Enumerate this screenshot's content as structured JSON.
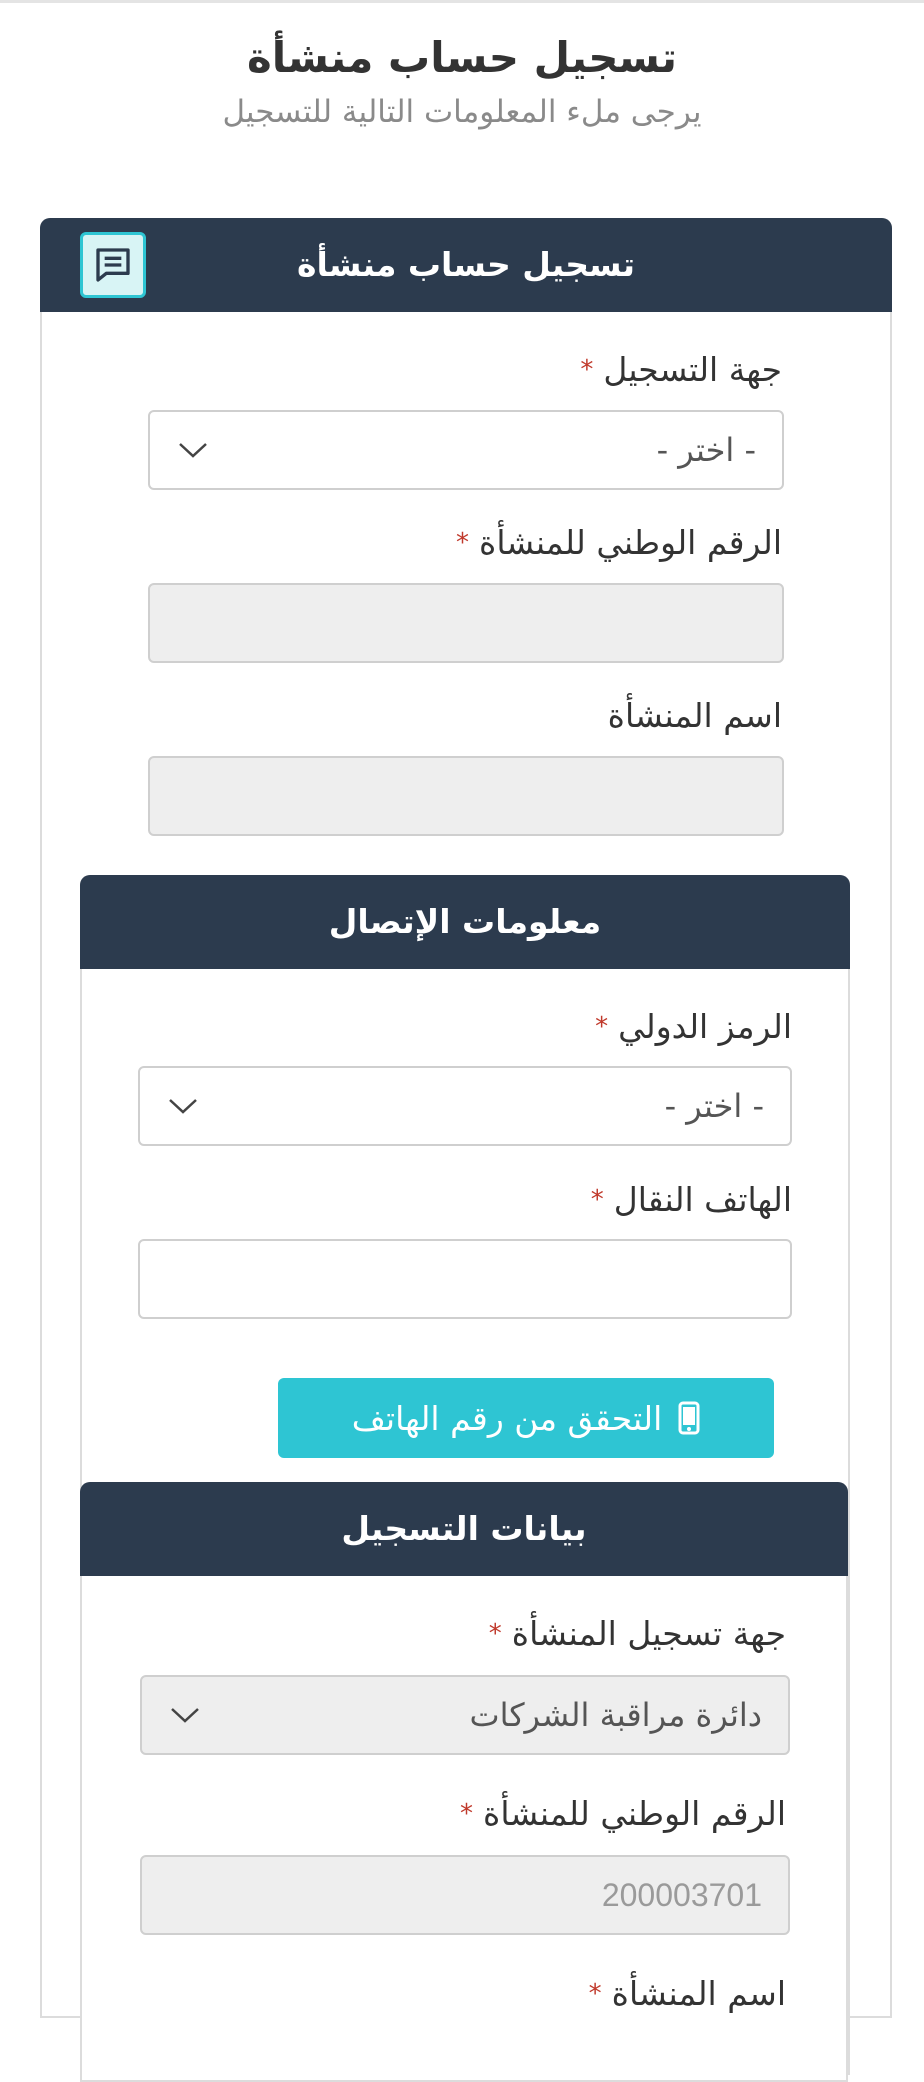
{
  "header": {
    "title": "تسجيل حساب منشأة",
    "subtitle": "يرجى ملء المعلومات التالية للتسجيل"
  },
  "panel_main": {
    "title": "تسجيل حساب منشأة",
    "chat_icon": "chat-icon",
    "registration_authority": {
      "label": "جهة التسجيل",
      "required_mark": "*",
      "value": "- اختر -"
    },
    "national_number": {
      "label": "الرقم الوطني للمنشأة",
      "required_mark": "*",
      "value": ""
    },
    "establishment_name": {
      "label": "اسم المنشأة",
      "value": ""
    }
  },
  "panel_contact": {
    "title": "معلومات الإتصال",
    "country_code": {
      "label": "الرمز الدولي",
      "required_mark": "*",
      "value": "- اختر -"
    },
    "mobile": {
      "label": "الهاتف النقال",
      "required_mark": "*",
      "value": ""
    },
    "verify_button": {
      "label": "التحقق من رقم الهاتف",
      "icon": "mobile-phone-icon"
    }
  },
  "panel_registration": {
    "title": "بيانات التسجيل",
    "registration_body": {
      "label": "جهة تسجيل المنشأة",
      "required_mark": "*",
      "value": "دائرة مراقبة الشركات"
    },
    "national_number": {
      "label": "الرقم الوطني للمنشأة",
      "required_mark": "*",
      "value": "200003701"
    },
    "establishment_name": {
      "label": "اسم المنشأة",
      "required_mark": "*"
    }
  },
  "colors": {
    "panel_header": "#2c3b4e",
    "accent": "#2ec5d3",
    "required": "#c0392b"
  }
}
